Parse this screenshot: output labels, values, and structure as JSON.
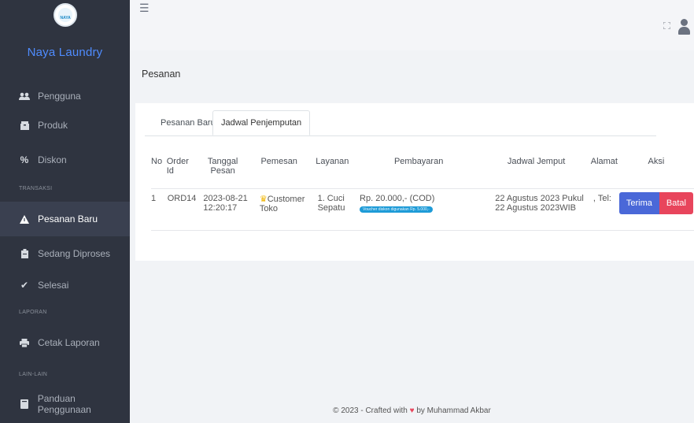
{
  "brand": {
    "logo_text": "NAYA",
    "name": "Naya Laundry"
  },
  "sidebar": {
    "items": [
      {
        "label": "Pengguna",
        "icon": "users-icon"
      },
      {
        "label": "Produk",
        "icon": "box-icon"
      },
      {
        "label": "Diskon",
        "icon": "percent-icon"
      },
      {
        "label": "Pesanan Baru",
        "icon": "warning-icon",
        "active": true
      },
      {
        "label": "Sedang Diproses",
        "icon": "clipboard-icon"
      },
      {
        "label": "Selesai",
        "icon": "check-icon"
      },
      {
        "label": "Cetak Laporan",
        "icon": "print-icon"
      },
      {
        "label": "Panduan Penggunaan",
        "icon": "book-icon"
      }
    ],
    "headers": [
      "TRANSAKSI",
      "LAPORAN",
      "LAIN-LAIN"
    ]
  },
  "topbar": {
    "menu_icon": "hamburger-icon",
    "expand_icon": "expand-icon",
    "user_icon": "user-icon"
  },
  "page": {
    "title": "Pesanan"
  },
  "tabs": [
    {
      "label": "Pesanan Baru"
    },
    {
      "label": "Jadwal Penjemputan",
      "active": true
    }
  ],
  "table": {
    "headers": [
      "No",
      "Order Id",
      "Tanggal Pesan",
      "Pemesan",
      "Layanan",
      "Pembayaran",
      "Jadwal Jemput",
      "Alamat",
      "Aksi"
    ],
    "rows": [
      {
        "no": "1",
        "order_id": "ORD14",
        "tanggal": "2023-08-21 12:20:17",
        "pemesan": "Customer Toko",
        "layanan": "1. Cuci Sepatu",
        "pembayaran": "Rp. 20.000,- (COD)",
        "voucher": "Voucher diskon digunakan Rp. 5.000,-",
        "jadwal": "22 Agustus 2023 Pukul 22 Agustus 2023WIB",
        "alamat": ", Tel:",
        "terima": "Terima",
        "batal": "Batal"
      }
    ]
  },
  "footer": {
    "prefix": "© 2023 - Crafted with",
    "suffix": "by Muhammad Akbar"
  },
  "colors": {
    "sidebar": "#2f3440",
    "brand": "#4f8cff",
    "terima": "#4a68d8",
    "batal": "#e8455c",
    "voucher": "#1e9bd7"
  }
}
